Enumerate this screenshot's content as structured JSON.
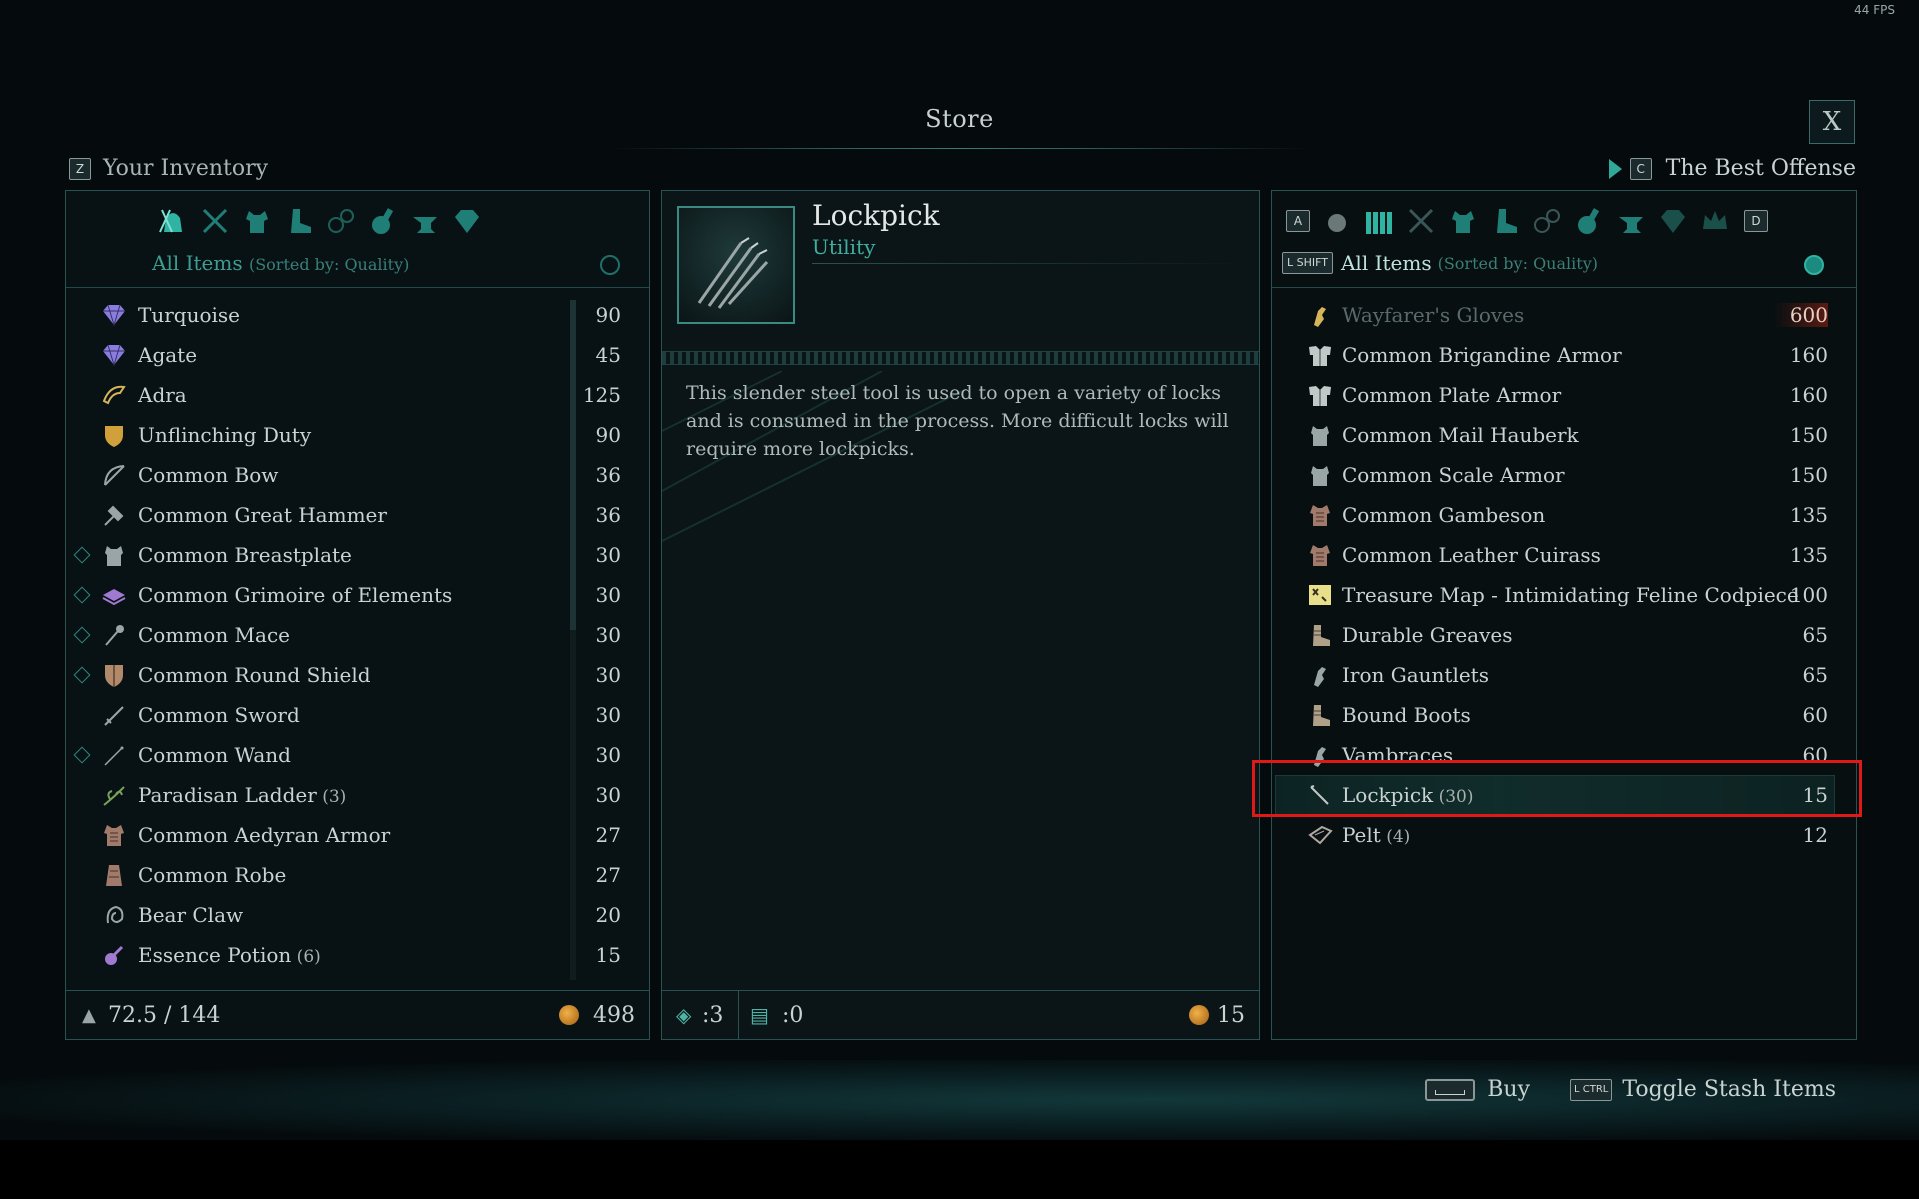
{
  "fps": "44 FPS",
  "title": "Store",
  "close_label": "X",
  "left_header": {
    "key": "Z",
    "label": "Your Inventory"
  },
  "right_header": {
    "key": "C",
    "label": "The Best Offense"
  },
  "left_panel": {
    "sort_label": "All Items",
    "sort_detail": "(Sorted by: Quality)",
    "items": [
      {
        "name": "Turquoise",
        "qty": "",
        "price": "90",
        "icon": "gem-icon",
        "color": "#8a7de0",
        "marker": false
      },
      {
        "name": "Agate",
        "qty": "",
        "price": "45",
        "icon": "gem-icon",
        "color": "#8a7de0",
        "marker": false
      },
      {
        "name": "Adra",
        "qty": "",
        "price": "125",
        "icon": "adra-icon",
        "color": "#d6b45a",
        "marker": false
      },
      {
        "name": "Unflinching Duty",
        "qty": "",
        "price": "90",
        "icon": "shield-icon",
        "color": "#d0a03a",
        "marker": false
      },
      {
        "name": "Common Bow",
        "qty": "",
        "price": "36",
        "icon": "bow-icon",
        "color": "#9aa6a6",
        "marker": false
      },
      {
        "name": "Common Great Hammer",
        "qty": "",
        "price": "36",
        "icon": "hammer-icon",
        "color": "#9aa6a6",
        "marker": false
      },
      {
        "name": "Common Breastplate",
        "qty": "",
        "price": "30",
        "icon": "breastplate-icon",
        "color": "#9aa6a6",
        "marker": true
      },
      {
        "name": "Common Grimoire of Elements",
        "qty": "",
        "price": "30",
        "icon": "grimoire-icon",
        "color": "#a07ad0",
        "marker": true
      },
      {
        "name": "Common Mace",
        "qty": "",
        "price": "30",
        "icon": "mace-icon",
        "color": "#9aa6a6",
        "marker": true
      },
      {
        "name": "Common Round Shield",
        "qty": "",
        "price": "30",
        "icon": "round-shield-icon",
        "color": "#b08a6a",
        "marker": true
      },
      {
        "name": "Common Sword",
        "qty": "",
        "price": "30",
        "icon": "sword-icon",
        "color": "#9aa6a6",
        "marker": false
      },
      {
        "name": "Common Wand",
        "qty": "",
        "price": "30",
        "icon": "wand-icon",
        "color": "#9aa6a6",
        "marker": true
      },
      {
        "name": "Paradisan Ladder",
        "qty": "(3)",
        "price": "30",
        "icon": "herb-icon",
        "color": "#7aa05a",
        "marker": false
      },
      {
        "name": "Common Aedyran Armor",
        "qty": "",
        "price": "27",
        "icon": "armor-icon",
        "color": "#a07a6a",
        "marker": false
      },
      {
        "name": "Common Robe",
        "qty": "",
        "price": "27",
        "icon": "robe-icon",
        "color": "#a07a6a",
        "marker": false
      },
      {
        "name": "Bear Claw",
        "qty": "",
        "price": "20",
        "icon": "claw-icon",
        "color": "#9aa6a6",
        "marker": false
      },
      {
        "name": "Essence Potion",
        "qty": "(6)",
        "price": "15",
        "icon": "potion-icon",
        "color": "#a07ad0",
        "marker": false
      }
    ],
    "weight": "72.5 / 144",
    "money": "498"
  },
  "detail": {
    "name": "Lockpick",
    "type": "Utility",
    "description": "This slender steel tool is used to open a variety of locks and is consumed in the process. More difficult locks will require more lockpicks.",
    "bag_count": ":3",
    "stash_count": ":0",
    "price": "15"
  },
  "right_panel": {
    "key_prev": "A",
    "key_next": "D",
    "shift_key": "L SHIFT",
    "sort_label": "All Items",
    "sort_detail": "(Sorted by: Quality)",
    "items": [
      {
        "name": "Wayfarer's Gloves",
        "qty": "",
        "price": "600",
        "icon": "gloves-icon",
        "color": "#d6b45a",
        "dim": true
      },
      {
        "name": "Common Brigandine Armor",
        "qty": "",
        "price": "160",
        "icon": "heavy-armor-icon",
        "color": "#c0c8c8",
        "dim": false
      },
      {
        "name": "Common Plate Armor",
        "qty": "",
        "price": "160",
        "icon": "heavy-armor-icon",
        "color": "#c0c8c8",
        "dim": false
      },
      {
        "name": "Common Mail Hauberk",
        "qty": "",
        "price": "150",
        "icon": "breastplate-icon",
        "color": "#9aa6a6",
        "dim": false
      },
      {
        "name": "Common Scale Armor",
        "qty": "",
        "price": "150",
        "icon": "breastplate-icon",
        "color": "#9aa6a6",
        "dim": false
      },
      {
        "name": "Common Gambeson",
        "qty": "",
        "price": "135",
        "icon": "armor-icon",
        "color": "#a07a6a",
        "dim": false
      },
      {
        "name": "Common Leather Cuirass",
        "qty": "",
        "price": "135",
        "icon": "armor-icon",
        "color": "#a07a6a",
        "dim": false
      },
      {
        "name": "Treasure Map - Intimidating Feline Codpiece",
        "qty": "",
        "price": "100",
        "icon": "treasure-map-icon",
        "color": "#e8df8a",
        "dim": false
      },
      {
        "name": "Durable Greaves",
        "qty": "",
        "price": "65",
        "icon": "boots-icon",
        "color": "#b0a08a",
        "dim": false
      },
      {
        "name": "Iron Gauntlets",
        "qty": "",
        "price": "65",
        "icon": "gloves-icon",
        "color": "#9aa6a6",
        "dim": false
      },
      {
        "name": "Bound Boots",
        "qty": "",
        "price": "60",
        "icon": "boots-icon",
        "color": "#b0a08a",
        "dim": false
      },
      {
        "name": "Vambraces",
        "qty": "",
        "price": "60",
        "icon": "gloves-icon",
        "color": "#9aa6a6",
        "dim": false
      },
      {
        "name": "Lockpick",
        "qty": "(30)",
        "price": "15",
        "icon": "lockpick-icon",
        "color": "#c0c8c8",
        "dim": false
      },
      {
        "name": "Pelt",
        "qty": "(4)",
        "price": "12",
        "icon": "pelt-icon",
        "color": "#b0a8a0",
        "dim": false
      }
    ]
  },
  "hints": {
    "buy_label": "Buy",
    "ctrl_key": "L CTRL",
    "toggle_label": "Toggle Stash Items"
  }
}
